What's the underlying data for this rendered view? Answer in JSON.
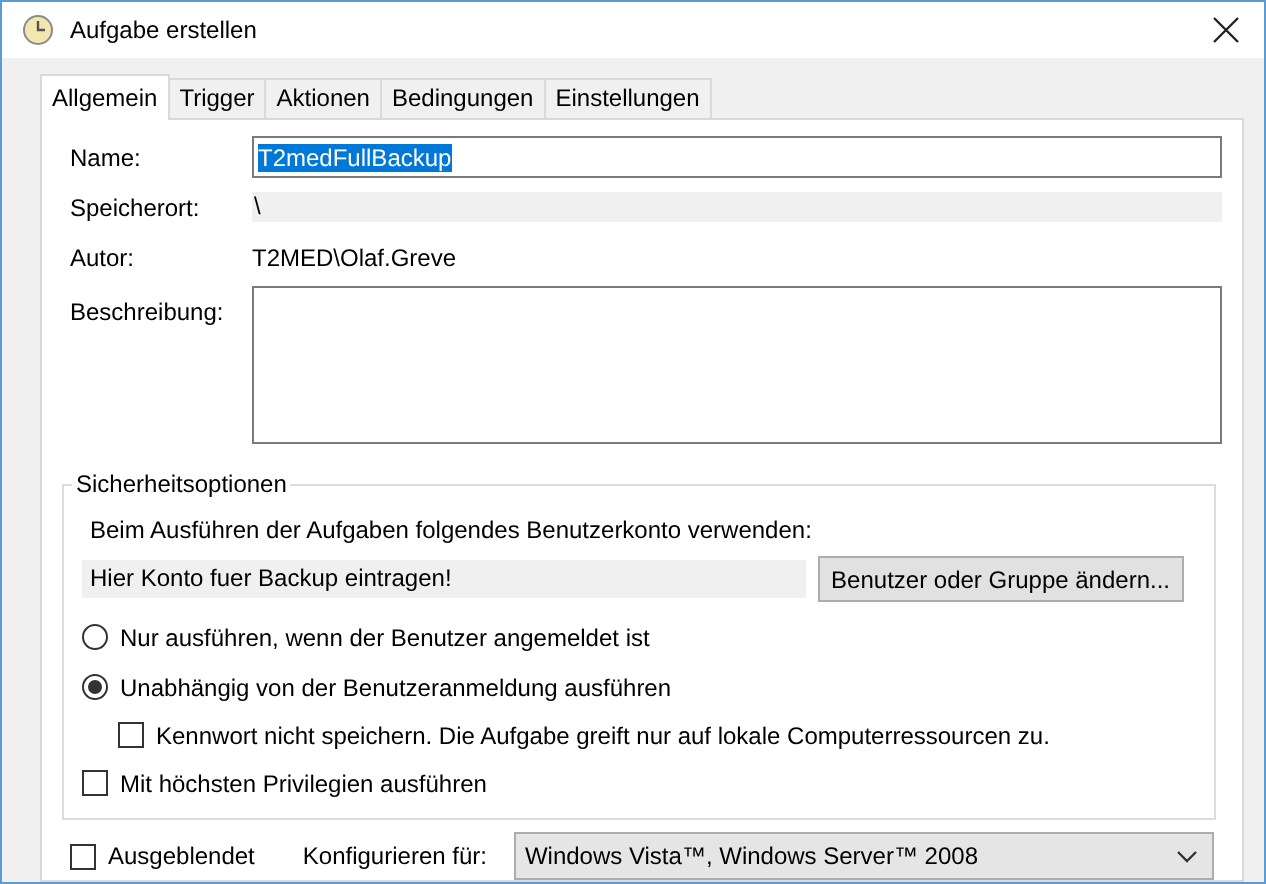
{
  "window": {
    "title": "Aufgabe erstellen"
  },
  "tabs": [
    {
      "label": "Allgemein",
      "selected": true
    },
    {
      "label": "Trigger",
      "selected": false
    },
    {
      "label": "Aktionen",
      "selected": false
    },
    {
      "label": "Bedingungen",
      "selected": false
    },
    {
      "label": "Einstellungen",
      "selected": false
    }
  ],
  "fields": [
    {
      "label": "Name:",
      "kind": "input",
      "value": "T2medFullBackup",
      "highlighted": true
    },
    {
      "label": "Speicherort:",
      "kind": "readonly",
      "value": "\\"
    },
    {
      "label": "Autor:",
      "kind": "text",
      "value": "T2MED\\Olaf.Greve"
    },
    {
      "label": "Beschreibung:",
      "kind": "textarea"
    }
  ],
  "security": {
    "title": "Sicherheitsoptionen",
    "prompt": "Beim Ausführen der Aufgaben folgendes Benutzerkonto verwenden:",
    "account": "Hier Konto fuer Backup eintragen!",
    "button": "Benutzer oder Gruppe ändern...",
    "options": [
      {
        "kind": "radio",
        "label": "Nur ausführen, wenn der Benutzer angemeldet ist",
        "selected": false
      },
      {
        "kind": "radio",
        "label": "Unabhängig von der Benutzeranmeldung ausführen",
        "selected": true,
        "children": [
          {
            "kind": "checkbox",
            "label": "Kennwort nicht speichern. Die Aufgabe greift nur auf lokale Computerressourcen zu.",
            "checked": false
          }
        ]
      },
      {
        "kind": "checkbox",
        "label": "Mit höchsten Privilegien ausführen",
        "checked": false
      }
    ]
  },
  "hidden": {
    "label": "Ausgeblendet",
    "checked": false
  },
  "configure": {
    "label": "Konfigurieren für:",
    "value": "Windows Vista™, Windows Server™ 2008"
  }
}
